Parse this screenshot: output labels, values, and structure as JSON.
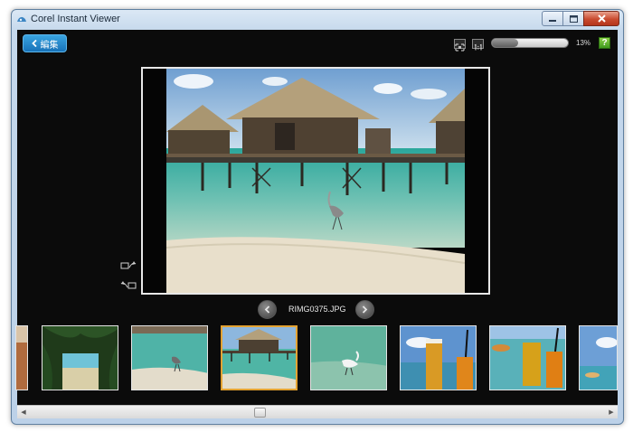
{
  "window": {
    "title": "Corel Instant Viewer",
    "icon": "corel-viewer-icon"
  },
  "toolbar": {
    "back_label": "編集",
    "zoom_percent": 13,
    "zoom_text": "13%",
    "help_label": "?"
  },
  "viewer": {
    "filename": "RIMG0375.JPG"
  },
  "filmstrip": {
    "thumbnails": [
      {
        "subject": "partial-photo"
      },
      {
        "subject": "palm-trees-beach"
      },
      {
        "subject": "heron-shore"
      },
      {
        "subject": "overwater-huts",
        "selected": true
      },
      {
        "subject": "egret-water"
      },
      {
        "subject": "orange-drinks"
      },
      {
        "subject": "drinks-on-deck"
      },
      {
        "subject": "sky-clouds"
      }
    ]
  },
  "colors": {
    "accent_button": "#1f86cc",
    "selected_thumb_border": "#e3a232",
    "help_green": "#5cb52e",
    "background": "#0b0b0b"
  }
}
